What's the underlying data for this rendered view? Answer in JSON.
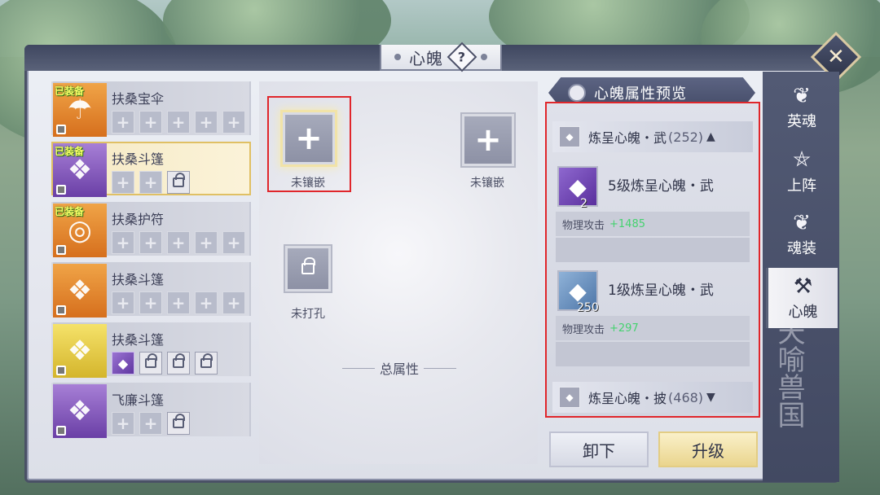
{
  "window": {
    "title": "心魄",
    "help_label": "?",
    "close_label": "✕"
  },
  "equipment_list": [
    {
      "name": "扶桑宝伞",
      "badge": "已装备",
      "rarity": "orange",
      "art": "☂",
      "slots": [
        "empty",
        "empty",
        "empty",
        "empty",
        "empty"
      ]
    },
    {
      "name": "扶桑斗篷",
      "badge": "已装备",
      "rarity": "purple",
      "art": "❖",
      "selected": true,
      "slots": [
        "empty",
        "empty",
        "locked"
      ]
    },
    {
      "name": "扶桑护符",
      "badge": "已装备",
      "rarity": "orange",
      "art": "◎",
      "slots": [
        "empty",
        "empty",
        "empty",
        "empty",
        "empty"
      ]
    },
    {
      "name": "扶桑斗篷",
      "badge": "",
      "rarity": "orange",
      "art": "❖",
      "slots": [
        "empty",
        "empty",
        "empty",
        "empty",
        "empty"
      ]
    },
    {
      "name": "扶桑斗篷",
      "badge": "",
      "rarity": "yellow",
      "art": "❖",
      "slots": [
        "gem",
        "locked",
        "locked",
        "locked"
      ]
    },
    {
      "name": "飞廉斗篷",
      "badge": "",
      "rarity": "purple",
      "art": "❖",
      "slots": [
        "empty",
        "empty",
        "locked"
      ]
    }
  ],
  "sockets": {
    "slot1_label": "未镶嵌",
    "slot2_label": "未镶嵌",
    "slot3_label": "未打孔",
    "total_attr_label": "总属性"
  },
  "preview": {
    "header": "心魄属性预览",
    "group1": {
      "name": "炼呈心魄・武",
      "count": "(252)",
      "arrow": "▲"
    },
    "gems": [
      {
        "name": "5级炼呈心魄・武",
        "qty": "2",
        "stat_label": "物理攻击",
        "stat_value": "+1485",
        "color": "purple"
      },
      {
        "name": "1级炼呈心魄・武",
        "qty": "250",
        "stat_label": "物理攻击",
        "stat_value": "+297",
        "color": "blue"
      }
    ],
    "group2": {
      "name": "炼呈心魄・披",
      "count": "(468)",
      "arrow": "▼"
    }
  },
  "side_tabs": [
    {
      "label": "英魂",
      "icon": "❦"
    },
    {
      "label": "上阵",
      "icon": "⛤"
    },
    {
      "label": "魂装",
      "icon": "❦"
    },
    {
      "label": "心魄",
      "icon": "⚒",
      "active": true
    }
  ],
  "watermark": "天喻兽国",
  "buttons": {
    "unload": "卸下",
    "upgrade": "升级"
  }
}
